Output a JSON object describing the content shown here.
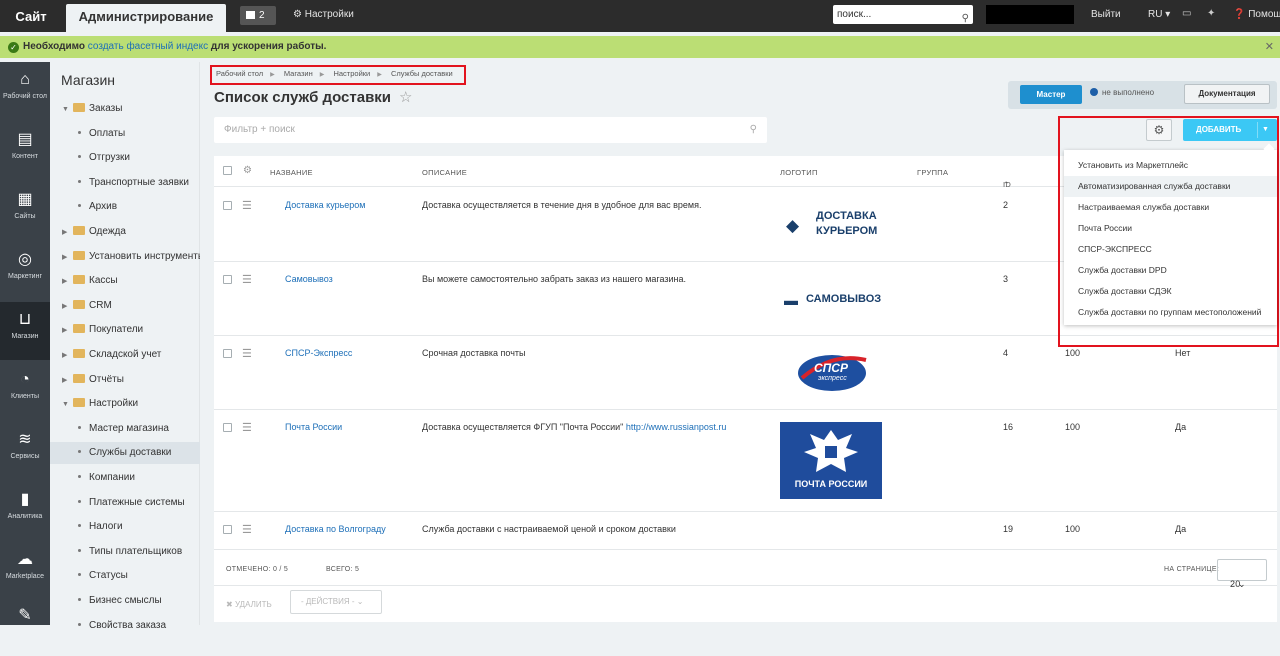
{
  "topbar": {
    "site_tab": "Сайт",
    "admin_tab": "Администрирование",
    "notifications": "2",
    "settings": "Настройки",
    "search_placeholder": "поиск...",
    "exit": "Выйти",
    "lang": "RU",
    "help": "Помощь"
  },
  "notice": {
    "prefix": "Необходимо",
    "link": "создать фасетный индекс",
    "suffix": "для ускорения работы."
  },
  "leftbar": [
    {
      "label": "Рабочий стол",
      "icon": "home-icon"
    },
    {
      "label": "Контент",
      "icon": "document-icon"
    },
    {
      "label": "Сайты",
      "icon": "calendar-icon"
    },
    {
      "label": "Маркетинг",
      "icon": "target-icon"
    },
    {
      "label": "Магазин",
      "icon": "basket-icon"
    },
    {
      "label": "Клиенты",
      "icon": "clock-24-icon"
    },
    {
      "label": "Сервисы",
      "icon": "layers-icon"
    },
    {
      "label": "Аналитика",
      "icon": "chart-icon"
    },
    {
      "label": "Marketplace",
      "icon": "download-cloud-icon"
    }
  ],
  "tree": {
    "title": "Магазин",
    "items": [
      {
        "label": "Заказы",
        "level": 0,
        "expanded": true
      },
      {
        "label": "Оплаты",
        "level": 1
      },
      {
        "label": "Отгрузки",
        "level": 1
      },
      {
        "label": "Транспортные заявки",
        "level": 1
      },
      {
        "label": "Архив",
        "level": 1
      },
      {
        "label": "Одежда",
        "level": 0
      },
      {
        "label": "Установить инструменты и",
        "level": 0
      },
      {
        "label": "Кассы",
        "level": 0
      },
      {
        "label": "CRM",
        "level": 0
      },
      {
        "label": "Покупатели",
        "level": 0
      },
      {
        "label": "Складской учет",
        "level": 0
      },
      {
        "label": "Отчёты",
        "level": 0
      },
      {
        "label": "Настройки",
        "level": 0,
        "expanded": true
      },
      {
        "label": "Мастер магазина",
        "level": 1
      },
      {
        "label": "Службы доставки",
        "level": 1,
        "selected": true
      },
      {
        "label": "Компании",
        "level": 1
      },
      {
        "label": "Платежные системы",
        "level": 1
      },
      {
        "label": "Налоги",
        "level": 1
      },
      {
        "label": "Типы плательщиков",
        "level": 1
      },
      {
        "label": "Статусы",
        "level": 1
      },
      {
        "label": "Бизнес смыслы",
        "level": 1
      },
      {
        "label": "Свойства заказа",
        "level": 1
      }
    ]
  },
  "breadcrumb": [
    "Рабочий стол",
    "Магазин",
    "Настройки",
    "Службы доставки"
  ],
  "page_title": "Список служб доставки",
  "master": {
    "button": "Мастер",
    "status": "не выполнено",
    "docs": "Документация"
  },
  "filter_placeholder": "Фильтр + поиск",
  "add_button": "ДОБАВИТЬ",
  "dropdown": [
    "Установить из Маркетплейс",
    "Автоматизированная служба доставки",
    "Настраиваемая служба доставки",
    "Почта России",
    "СПСР-ЭКСПРЕСС",
    "Служба доставки DPD",
    "Служба доставки СДЭК",
    "Служба доставки по группам местоположений"
  ],
  "columns": {
    "name": "НАЗВАНИЕ",
    "description": "ОПИСАНИЕ",
    "logo": "ЛОГОТИП",
    "group": "ГРУППА",
    "id": "ID"
  },
  "rows": [
    {
      "name": "Доставка курьером",
      "description": "Доставка осуществляется в течение дня в удобное для вас время.",
      "id": "2",
      "sort": "",
      "active": "",
      "logo": "courier"
    },
    {
      "name": "Самовывоз",
      "description": "Вы можете самостоятельно забрать заказ из нашего магазина.",
      "id": "3",
      "sort": "",
      "active": "",
      "logo": "pickup"
    },
    {
      "name": "СПСР-Экспресс",
      "description": "Срочная доставка почты",
      "id": "4",
      "sort": "100",
      "active": "Нет",
      "logo": "spsr"
    },
    {
      "name": "Почта России",
      "description": "Доставка осуществляется ФГУП \"Почта России\"",
      "link": "http://www.russianpost.ru",
      "id": "16",
      "sort": "100",
      "active": "Да",
      "logo": "post"
    },
    {
      "name": "Доставка по Волгограду",
      "description": "Служба доставки с настраиваемой ценой и сроком доставки",
      "id": "19",
      "sort": "100",
      "active": "Да",
      "logo": ""
    }
  ],
  "logos": {
    "courier_line1": "ДОСТАВКА",
    "courier_line2": "КУРЬЕРОМ",
    "pickup": "САМОВЫВОЗ",
    "spsr_main": "СПСР",
    "spsr_sub": "экспресс",
    "post": "ПОЧТА РОССИИ"
  },
  "footer": {
    "selected": "ОТМЕЧЕНО: 0 / 5",
    "total": "ВСЕГО: 5",
    "per_page_label": "НА СТРАНИЦЕ:",
    "per_page": "20"
  },
  "actions": {
    "delete": "УДАЛИТЬ",
    "select": "- ДЕЙСТВИЯ -"
  },
  "colors": {
    "accent": "#3bc8f5",
    "red_highlight": "#e2131e",
    "link": "#1d6fb8",
    "notice": "#bbde74"
  }
}
